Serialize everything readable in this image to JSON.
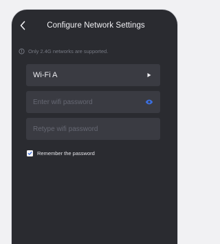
{
  "header": {
    "title": "Configure Network Settings",
    "back_icon": "chevron-left-icon"
  },
  "notice": {
    "icon": "info-circle-icon",
    "text": "Only 2.4G networks are supported."
  },
  "form": {
    "ssid": {
      "value": "Wi-Fi A",
      "icon": "triangle-right-icon"
    },
    "password": {
      "placeholder": "Enter wifi password",
      "icon": "eye-icon"
    },
    "retype_password": {
      "placeholder": "Retype wifi password"
    },
    "remember": {
      "label": "Remember the password",
      "checked": true
    }
  },
  "colors": {
    "background": "#2a2b30",
    "field": "#3a3b42",
    "accent": "#3b6fe0",
    "text": "#f2f2f5",
    "muted": "#777a84"
  }
}
